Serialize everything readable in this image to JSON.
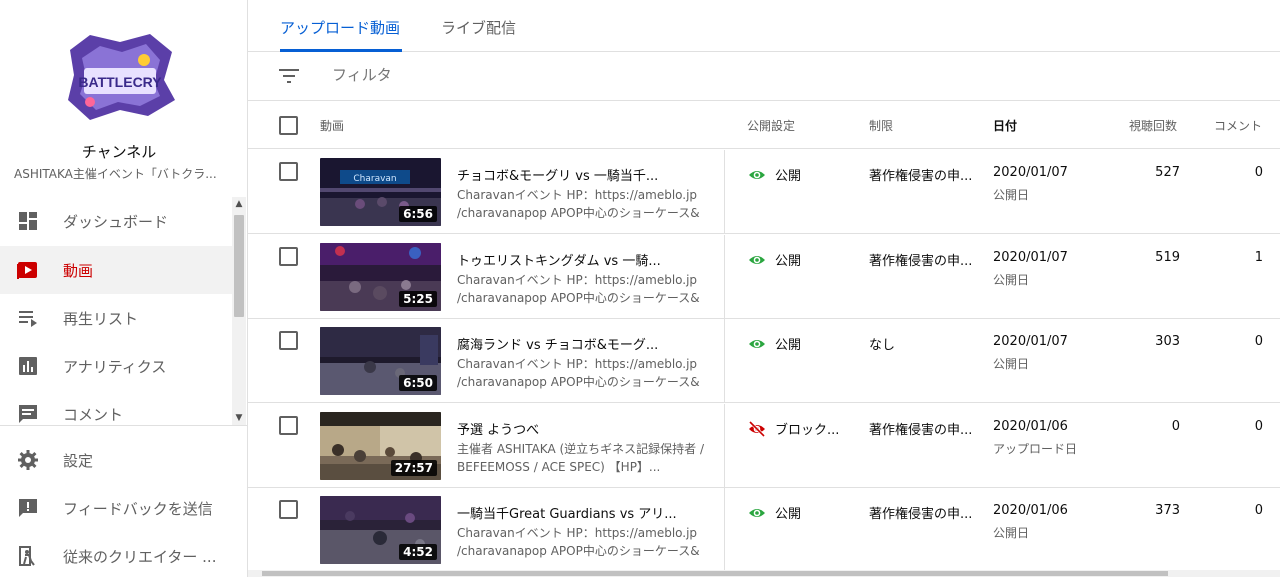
{
  "sidebar": {
    "logo_text": "BATTLECRY",
    "channel_title": "チャンネル",
    "channel_sub": "ASHITAKA主催イベント「バトクラ...",
    "items": [
      {
        "label": "ダッシュボード",
        "icon": "dashboard-icon"
      },
      {
        "label": "動画",
        "icon": "video-icon"
      },
      {
        "label": "再生リスト",
        "icon": "playlist-icon"
      },
      {
        "label": "アナリティクス",
        "icon": "analytics-icon"
      },
      {
        "label": "コメント",
        "icon": "comment-icon"
      }
    ],
    "bottom_items": [
      {
        "label": "設定",
        "icon": "settings-icon"
      },
      {
        "label": "フィードバックを送信",
        "icon": "feedback-icon"
      },
      {
        "label": "従来のクリエイター ...",
        "icon": "exit-icon"
      }
    ]
  },
  "tabs": [
    "アップロード動画",
    "ライブ配信"
  ],
  "filter": {
    "placeholder": "フィルタ"
  },
  "columns": {
    "video": "動画",
    "visibility": "公開設定",
    "restrictions": "制限",
    "date": "日付",
    "views": "視聴回数",
    "comments": "コメント"
  },
  "rows": [
    {
      "title": "チョコボ&モーグリ vs 一騎当千...",
      "desc1": "Charavanイベント HP：https://ameblo.jp",
      "desc2": "/charavanapop APOP中心のショーケース&ミ...",
      "duration": "6:56",
      "visibility": "公開",
      "restriction": "著作権侵害の申...",
      "date": "2020/01/07",
      "date_type": "公開日",
      "views": "527",
      "comments": "0"
    },
    {
      "title": "トゥエリストキングダム vs 一騎...",
      "desc1": "Charavanイベント HP：https://ameblo.jp",
      "desc2": "/charavanapop APOP中心のショーケース&ミ...",
      "duration": "5:25",
      "visibility": "公開",
      "restriction": "著作権侵害の申...",
      "date": "2020/01/07",
      "date_type": "公開日",
      "views": "519",
      "comments": "1"
    },
    {
      "title": "腐海ランド vs チョコボ&モーグ...",
      "desc1": "Charavanイベント HP：https://ameblo.jp",
      "desc2": "/charavanapop APOP中心のショーケース&ミ...",
      "duration": "6:50",
      "visibility": "公開",
      "restriction": "なし",
      "date": "2020/01/07",
      "date_type": "公開日",
      "views": "303",
      "comments": "0"
    },
    {
      "title": "予選 ようつべ",
      "desc1": "主催者 ASHITAKA (逆立ちギネス記録保持者 /",
      "desc2": "BEFEEMOSS / ACE SPEC) 【HP】...",
      "duration": "27:57",
      "visibility": "ブロック...",
      "restriction": "著作権侵害の申...",
      "date": "2020/01/06",
      "date_type": "アップロード日",
      "views": "0",
      "comments": "0"
    },
    {
      "title": "一騎当千Great Guardians vs アリ...",
      "desc1": "Charavanイベント HP：https://ameblo.jp",
      "desc2": "/charavanapop APOP中心のショーケース&ミ...",
      "duration": "4:52",
      "visibility": "公開",
      "restriction": "著作権侵害の申...",
      "date": "2020/01/06",
      "date_type": "公開日",
      "views": "373",
      "comments": "0"
    }
  ],
  "colors": {
    "accent_blue": "#065fd4",
    "active_red": "#cc0000",
    "eye_green": "#2ba640",
    "blocked_red": "#cc0000"
  }
}
